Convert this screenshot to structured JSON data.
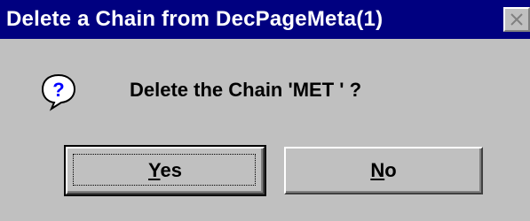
{
  "window": {
    "title": "Delete a Chain from DecPageMeta(1)",
    "close_icon": "close-x-icon"
  },
  "message": {
    "icon": "question-icon",
    "text": "Delete the Chain 'MET ' ?"
  },
  "buttons": {
    "yes": {
      "accel": "Y",
      "rest": "es"
    },
    "no": {
      "accel": "N",
      "rest": "o"
    }
  },
  "colors": {
    "titlebar": "#000080",
    "face": "#c0c0c0",
    "text": "#000000",
    "title_text": "#ffffff"
  }
}
